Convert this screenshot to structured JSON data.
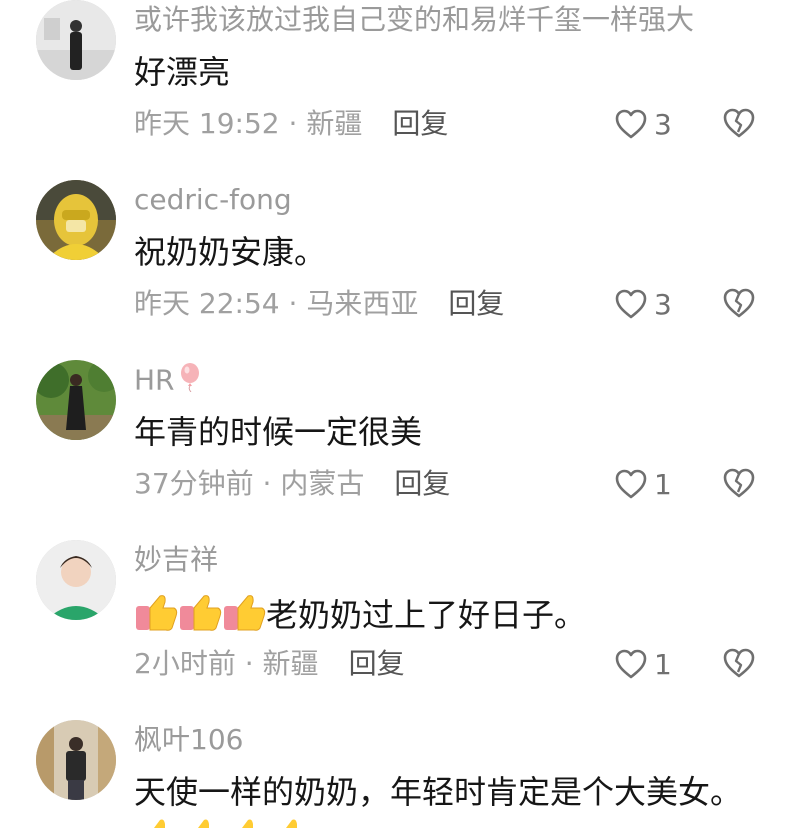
{
  "comments": [
    {
      "username": "或许我该放过我自己变的和易烊千玺一样强大",
      "text": "好漂亮",
      "time": "昨天 19:52",
      "location": "新疆",
      "reply": "回复",
      "likes": "3",
      "icon": "heart-icon"
    },
    {
      "username": "cedric-fong",
      "text": "祝奶奶安康。",
      "time": "昨天 22:54",
      "location": "马来西亚",
      "reply": "回复",
      "likes": "3",
      "icon": "heart-icon"
    },
    {
      "username": "HR",
      "text": "年青的时候一定很美",
      "time": "37分钟前",
      "location": "内蒙古",
      "reply": "回复",
      "likes": "1",
      "icon": "heart-icon"
    },
    {
      "username": "妙吉祥",
      "text": "老奶奶过上了好日子。",
      "time": "2小时前",
      "location": "新疆",
      "reply": "回复",
      "likes": "1",
      "icon": "heart-icon"
    },
    {
      "username": "枫叶106",
      "text": "天使一样的奶奶，年轻时肯定是个大美女。"
    }
  ],
  "sep": "·",
  "colors": {
    "text": "#161616",
    "meta": "#a0a0a0",
    "username": "#9a9a9a"
  }
}
